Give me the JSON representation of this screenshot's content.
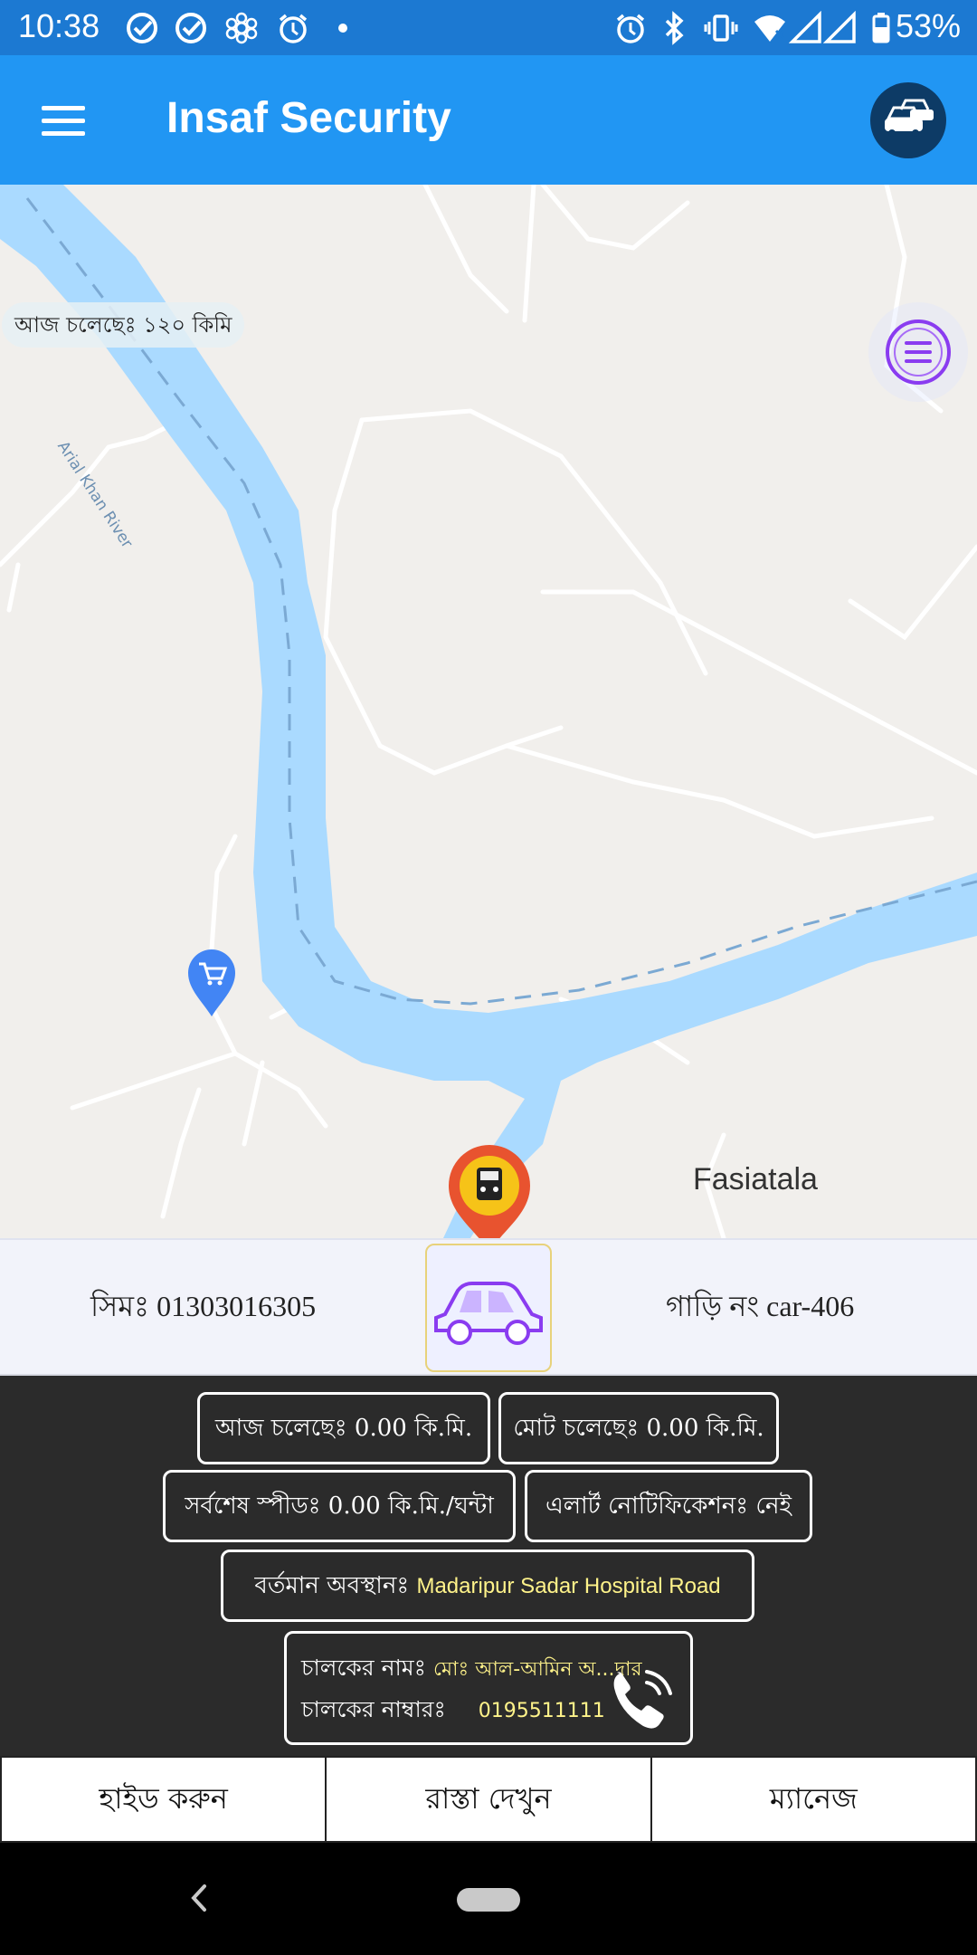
{
  "status_bar": {
    "time": "10:38",
    "battery": "53%",
    "left_icons": [
      "check-circle-icon",
      "check-circle-icon",
      "gear-flower-icon",
      "alarm-icon",
      "dot-icon"
    ],
    "right_icons": [
      "alarm-icon",
      "bluetooth-icon",
      "vibrate-icon",
      "wifi-icon",
      "signal-icon",
      "signal-icon",
      "battery-icon"
    ]
  },
  "app_bar": {
    "title": "Insaf Security",
    "menu_icon": "hamburger-menu-icon",
    "action_icon": "cars-icon"
  },
  "map": {
    "today_distance_pill": "আজ চলেছেঃ ১২০ কিমি",
    "place_label": "Fasiatala",
    "river_label": "Arial Khan River",
    "layers_fab_icon": "list-menu-icon",
    "shop_marker_icon": "shopping-cart-icon",
    "vehicle_marker_icon": "vehicle-marker-icon",
    "colors": {
      "land": "#f1efec",
      "water": "#aadaff",
      "road": "#ffffff"
    }
  },
  "info_strip": {
    "sim": "সিমঃ 01303016305",
    "plate": "গাড়ি নং car-406",
    "car_icon": "car-icon"
  },
  "panel": {
    "today_distance": "আজ চলেছেঃ 0.00  কি.মি.",
    "total_distance": "মোট চলেছেঃ 0.00 কি.মি.",
    "last_speed": "সর্বশেষ স্পীডঃ 0.00 কি.মি./ঘন্টা",
    "alert_notification": "এলার্ট নোটিফিকেশনঃ নেই",
    "location_label": "বর্তমান অবস্থানঃ",
    "location_value": "Madaripur Sadar Hospital Road",
    "driver_name_label": "চালকের নামঃ",
    "driver_name_value": "মোঃ আল-আমিন অ...দার",
    "driver_number_label": "চালকের নাম্বারঃ",
    "driver_number_value": "0195511111",
    "phone_icon": "phone-call-icon"
  },
  "tabs": [
    {
      "label": "হাইড করুন"
    },
    {
      "label": "রাস্তা দেখুন"
    },
    {
      "label": "ম্যানেজ"
    }
  ],
  "nav_bar": {
    "back_icon": "back-chevron-icon",
    "home_icon": "home-pill-icon"
  }
}
